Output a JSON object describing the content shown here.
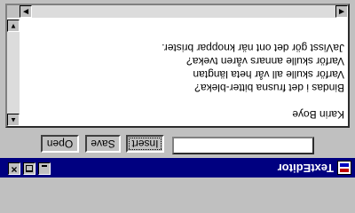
{
  "window": {
    "title": "TextEditor",
    "close_glyph": "×"
  },
  "toolbar": {
    "input_value": "",
    "insert_label": "Insert",
    "save_label": "Save",
    "open_label": "Open"
  },
  "editor": {
    "lines": [
      "Karin Boye",
      "",
      "Bindas i det frusna bitter-bleka?",
      "Varför skulle all vår heta längtan",
      "Varför skulle annars våren tveka?",
      "JaVisst gör det ont när knoppar brister."
    ]
  },
  "scrollbars": {
    "up_glyph": "▲",
    "down_glyph": "▼",
    "left_glyph": "◀",
    "right_glyph": "▶"
  },
  "icons": {
    "app": "java-cup-icon",
    "minimize": "minimize-icon",
    "maximize": "maximize-icon",
    "close": "close-icon"
  }
}
